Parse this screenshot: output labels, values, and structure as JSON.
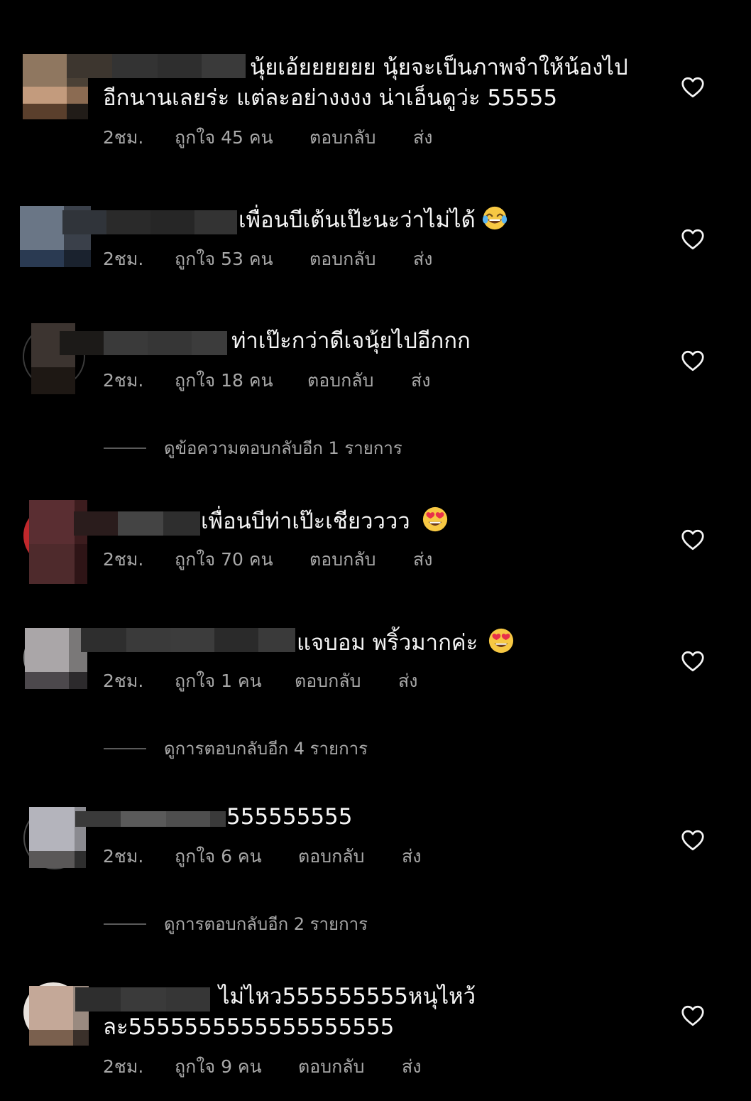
{
  "comments": [
    {
      "text_line1": "นุ้ยเอ้ยยยยยย นุ้ยจะเป็นภาพจำให้น้องไป",
      "text_line2": "อีกนานเลยร่ะ แต่ละอย่างงงง น่าเอ็นดูว่ะ 55555",
      "time": "2ชม.",
      "likes": "ถูกใจ 45 คน",
      "reply": "ตอบกลับ",
      "send": "ส่ง"
    },
    {
      "text_line1": "เพื่อนบีเต้นเป๊ะนะว่าไม่ได้",
      "emoji": "face-with-tears-of-joy-emoji",
      "time": "2ชม.",
      "likes": "ถูกใจ 53 คน",
      "reply": "ตอบกลับ",
      "send": "ส่ง"
    },
    {
      "text_line1": "ท่าเป๊ะกว่าดีเจนุ้ยไปอีกกก",
      "time": "2ชม.",
      "likes": "ถูกใจ 18 คน",
      "reply": "ตอบกลับ",
      "send": "ส่ง",
      "view_replies": "ดูข้อความตอบกลับอีก 1 รายการ"
    },
    {
      "text_line1": "เพื่อนบีท่าเป๊ะเชียวววว",
      "emoji": "heart-eyes-emoji",
      "time": "2ชม.",
      "likes": "ถูกใจ 70 คน",
      "reply": "ตอบกลับ",
      "send": "ส่ง"
    },
    {
      "text_line1": "แจบอม พริ้วมากค่ะ",
      "emoji": "heart-eyes-emoji",
      "time": "2ชม.",
      "likes": "ถูกใจ 1 คน",
      "reply": "ตอบกลับ",
      "send": "ส่ง",
      "view_replies": "ดูการตอบกลับอีก 4 รายการ"
    },
    {
      "text_line1": "555555555",
      "time": "2ชม.",
      "likes": "ถูกใจ 6 คน",
      "reply": "ตอบกลับ",
      "send": "ส่ง",
      "view_replies": "ดูการตอบกลับอีก 2 รายการ"
    },
    {
      "text_line1": "ไม่ไหว555555555หนุไหว้",
      "text_line2": "ละ5555555555555555555",
      "time": "2ชม.",
      "likes": "ถูกใจ 9 คน",
      "reply": "ตอบกลับ",
      "send": "ส่ง"
    }
  ],
  "icons": {
    "like": "heart-outline-icon"
  },
  "colors": {
    "background": "#000000",
    "text": "#f5f5f5",
    "meta": "#a8a8a8"
  }
}
